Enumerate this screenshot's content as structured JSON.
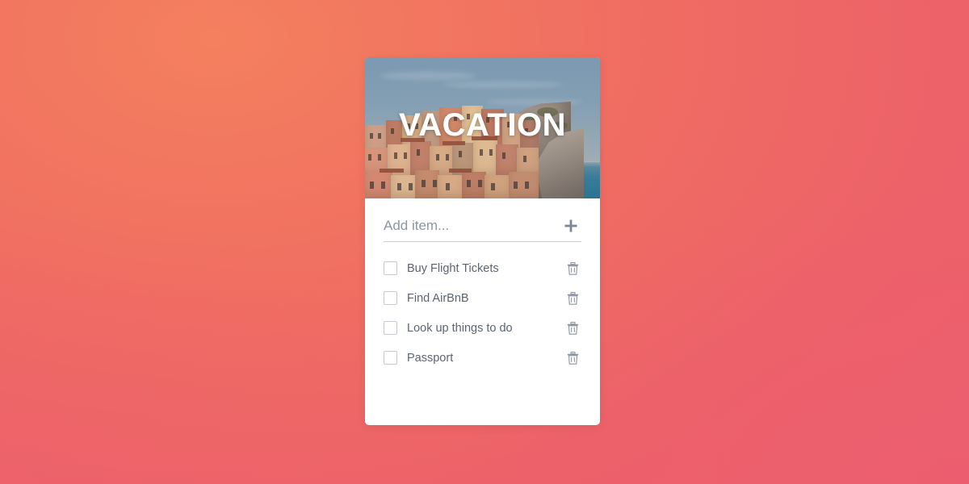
{
  "background": {
    "gradient_from": "#f4805f",
    "gradient_to": "#ec5f6e"
  },
  "card": {
    "hero": {
      "title": "VACATION",
      "image_alt": "cliffside-village-photo",
      "title_color": "#ffffff"
    },
    "add_row": {
      "placeholder": "Add item...",
      "value": "",
      "add_icon": "plus-icon"
    },
    "items": [
      {
        "label": "Buy Flight Tickets",
        "checked": false,
        "delete_icon": "trash-icon"
      },
      {
        "label": "Find AirBnB",
        "checked": false,
        "delete_icon": "trash-icon"
      },
      {
        "label": "Look up things to do",
        "checked": false,
        "delete_icon": "trash-icon"
      },
      {
        "label": "Passport",
        "checked": false,
        "delete_icon": "trash-icon"
      }
    ]
  }
}
